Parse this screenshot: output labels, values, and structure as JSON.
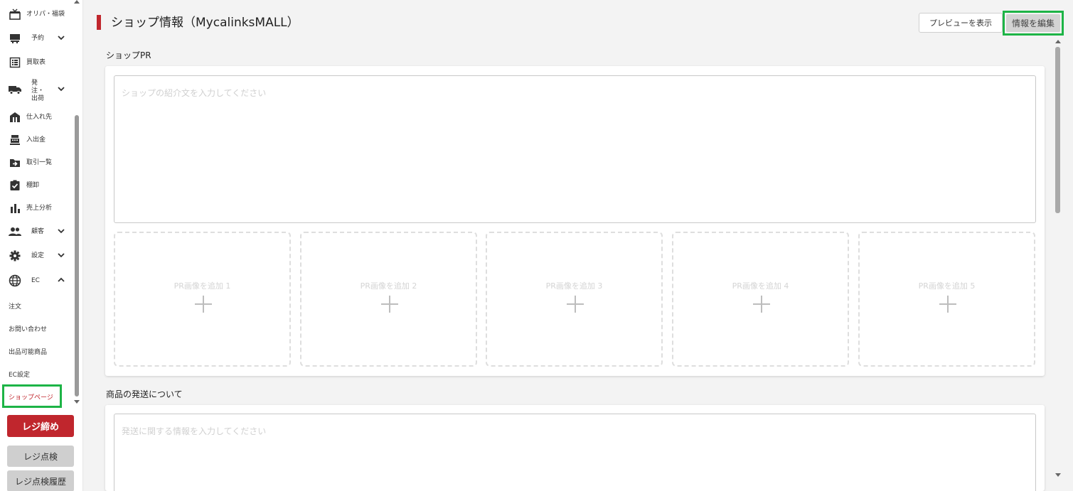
{
  "sidebar": {
    "items": [
      {
        "label": "オリパ・福袋",
        "icon": "gift-box-icon"
      },
      {
        "label": "予約",
        "icon": "reservation-icon",
        "chevron": "down"
      },
      {
        "label": "買取表",
        "icon": "list-table-icon"
      },
      {
        "label": "発注・出荷",
        "icon": "truck-icon",
        "chevron": "down"
      },
      {
        "label": "仕入れ先",
        "icon": "factory-icon"
      },
      {
        "label": "入出金",
        "icon": "cash-register-icon"
      },
      {
        "label": "取引一覧",
        "icon": "folder-arrow-icon"
      },
      {
        "label": "棚卸",
        "icon": "clipboard-check-icon"
      },
      {
        "label": "売上分析",
        "icon": "bar-chart-icon"
      },
      {
        "label": "顧客",
        "icon": "people-icon",
        "chevron": "down"
      },
      {
        "label": "設定",
        "icon": "gear-icon",
        "chevron": "down"
      },
      {
        "label": "EC",
        "icon": "globe-icon",
        "chevron": "up"
      }
    ],
    "ec_sub_items": [
      "注文",
      "お問い合わせ",
      "出品可能商品",
      "EC設定"
    ],
    "active_item": "ショップページ",
    "close_register_label": "レジ締め",
    "register_check_label": "レジ点検",
    "register_history_label": "レジ点検履歴"
  },
  "header": {
    "title": "ショップ情報（MycalinksMALL）",
    "preview_label": "プレビューを表示",
    "edit_label": "情報を編集"
  },
  "shop_pr": {
    "section_label": "ショップPR",
    "placeholder": "ショップの紹介文を入力してください",
    "image_slots": [
      "PR画像を追加 1",
      "PR画像を追加 2",
      "PR画像を追加 3",
      "PR画像を追加 4",
      "PR画像を追加 5"
    ]
  },
  "shipping": {
    "section_label": "商品の発送について",
    "placeholder": "発送に関する情報を入力してください"
  },
  "colors": {
    "accent_red": "#c0262d",
    "highlight_green": "#1db446"
  }
}
